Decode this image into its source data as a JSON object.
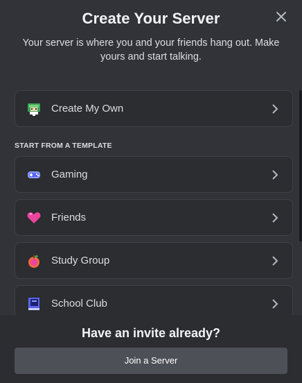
{
  "modal": {
    "title": "Create Your Server",
    "subtitle": "Your server is where you and your friends hang out. Make yours and start talking.",
    "close_icon": "close-icon"
  },
  "options": {
    "create_own": {
      "label": "Create My Own",
      "icon": "create-server-icon"
    },
    "section_label": "START FROM A TEMPLATE",
    "templates": [
      {
        "label": "Gaming",
        "icon": "gamepad-icon"
      },
      {
        "label": "Friends",
        "icon": "heart-icon"
      },
      {
        "label": "Study Group",
        "icon": "apple-icon"
      },
      {
        "label": "School Club",
        "icon": "book-icon"
      }
    ],
    "chevron_icon": "chevron-right-icon"
  },
  "footer": {
    "title": "Have an invite already?",
    "join_label": "Join a Server"
  },
  "colors": {
    "background": "#313338",
    "card": "#2b2d31",
    "button": "#4e5058"
  }
}
